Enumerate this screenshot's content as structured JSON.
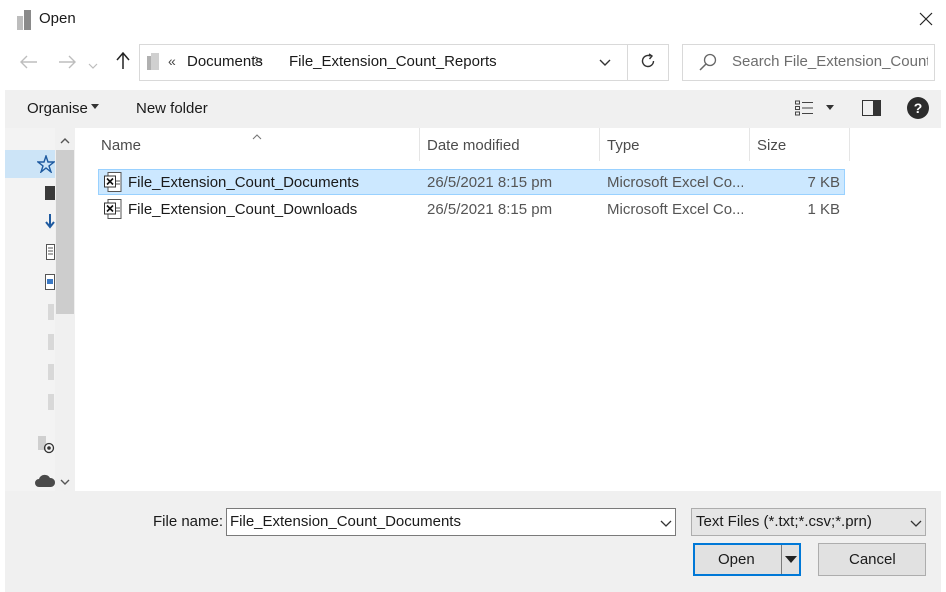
{
  "window": {
    "title": "Open",
    "close_icon": "close-icon"
  },
  "navigation": {
    "back_icon": "arrow-left-icon",
    "forward_icon": "arrow-right-icon",
    "recent_icon": "chevron-down-icon",
    "up_icon": "arrow-up-icon",
    "breadcrumb": {
      "overflow": "«",
      "items": [
        "Documents",
        "File_Extension_Count_Reports"
      ],
      "separator": ">"
    },
    "refresh_icon": "refresh-icon",
    "search_placeholder": "Search File_Extension_Count_..."
  },
  "toolbar": {
    "organise_label": "Organise",
    "new_folder_label": "New folder",
    "view_icon": "view-details-icon",
    "preview_pane_icon": "preview-pane-icon",
    "help_label": "?"
  },
  "columns": {
    "name": "Name",
    "date_modified": "Date modified",
    "type": "Type",
    "size": "Size"
  },
  "files": [
    {
      "name": "File_Extension_Count_Documents",
      "date_modified": "26/5/2021 8:15 pm",
      "type": "Microsoft Excel Co...",
      "size": "7 KB",
      "icon": "excel-csv-icon",
      "selected": true
    },
    {
      "name": "File_Extension_Count_Downloads",
      "date_modified": "26/5/2021 8:15 pm",
      "type": "Microsoft Excel Co...",
      "size": "1 KB",
      "icon": "excel-csv-icon",
      "selected": false
    }
  ],
  "footer": {
    "file_name_label": "File name:",
    "file_name_value": "File_Extension_Count_Documents",
    "file_type_value": "Text Files (*.txt;*.csv;*.prn)",
    "open_label": "Open",
    "cancel_label": "Cancel"
  },
  "colors": {
    "selection_bg": "#cce8ff",
    "selection_border": "#99d1ff",
    "accent": "#0078d7"
  }
}
